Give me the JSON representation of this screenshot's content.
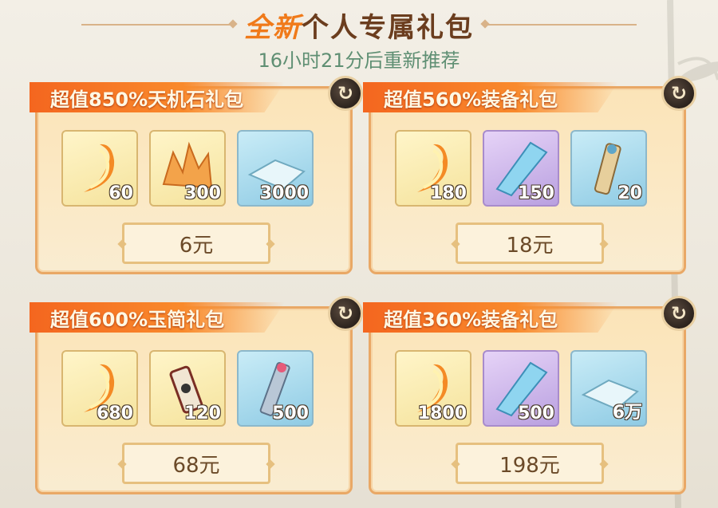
{
  "header": {
    "title_highlight": "全新",
    "title_rest": "个人专属礼包",
    "refresh_timer": "16小时21分后重新推荐"
  },
  "colors": {
    "ribbon": "#f4661f",
    "card_border": "#e9a866",
    "subtitle": "#5f8f73",
    "title": "#6b3d1e"
  },
  "packs": [
    {
      "title": "超值850%天机石礼包",
      "items": [
        {
          "icon": "flame-feather-icon",
          "qty": "60"
        },
        {
          "icon": "orange-crystal-icon",
          "qty": "300"
        },
        {
          "icon": "silver-cloth-icon",
          "qty": "3000"
        }
      ],
      "price": "6元"
    },
    {
      "title": "超值560%装备礼包",
      "items": [
        {
          "icon": "flame-feather-icon",
          "qty": "180"
        },
        {
          "icon": "blue-crystal-icon",
          "qty": "150"
        },
        {
          "icon": "scroll-icon",
          "qty": "20"
        }
      ],
      "price": "18元"
    },
    {
      "title": "超值600%玉简礼包",
      "items": [
        {
          "icon": "flame-feather-icon",
          "qty": "680"
        },
        {
          "icon": "red-scroll-icon",
          "qty": "120"
        },
        {
          "icon": "jade-slip-icon",
          "qty": "500"
        }
      ],
      "price": "68元"
    },
    {
      "title": "超值360%装备礼包",
      "items": [
        {
          "icon": "flame-feather-icon",
          "qty": "1800"
        },
        {
          "icon": "blue-crystal-icon",
          "qty": "500"
        },
        {
          "icon": "silver-cloth-icon",
          "qty": "6万"
        }
      ],
      "price": "198元"
    }
  ]
}
